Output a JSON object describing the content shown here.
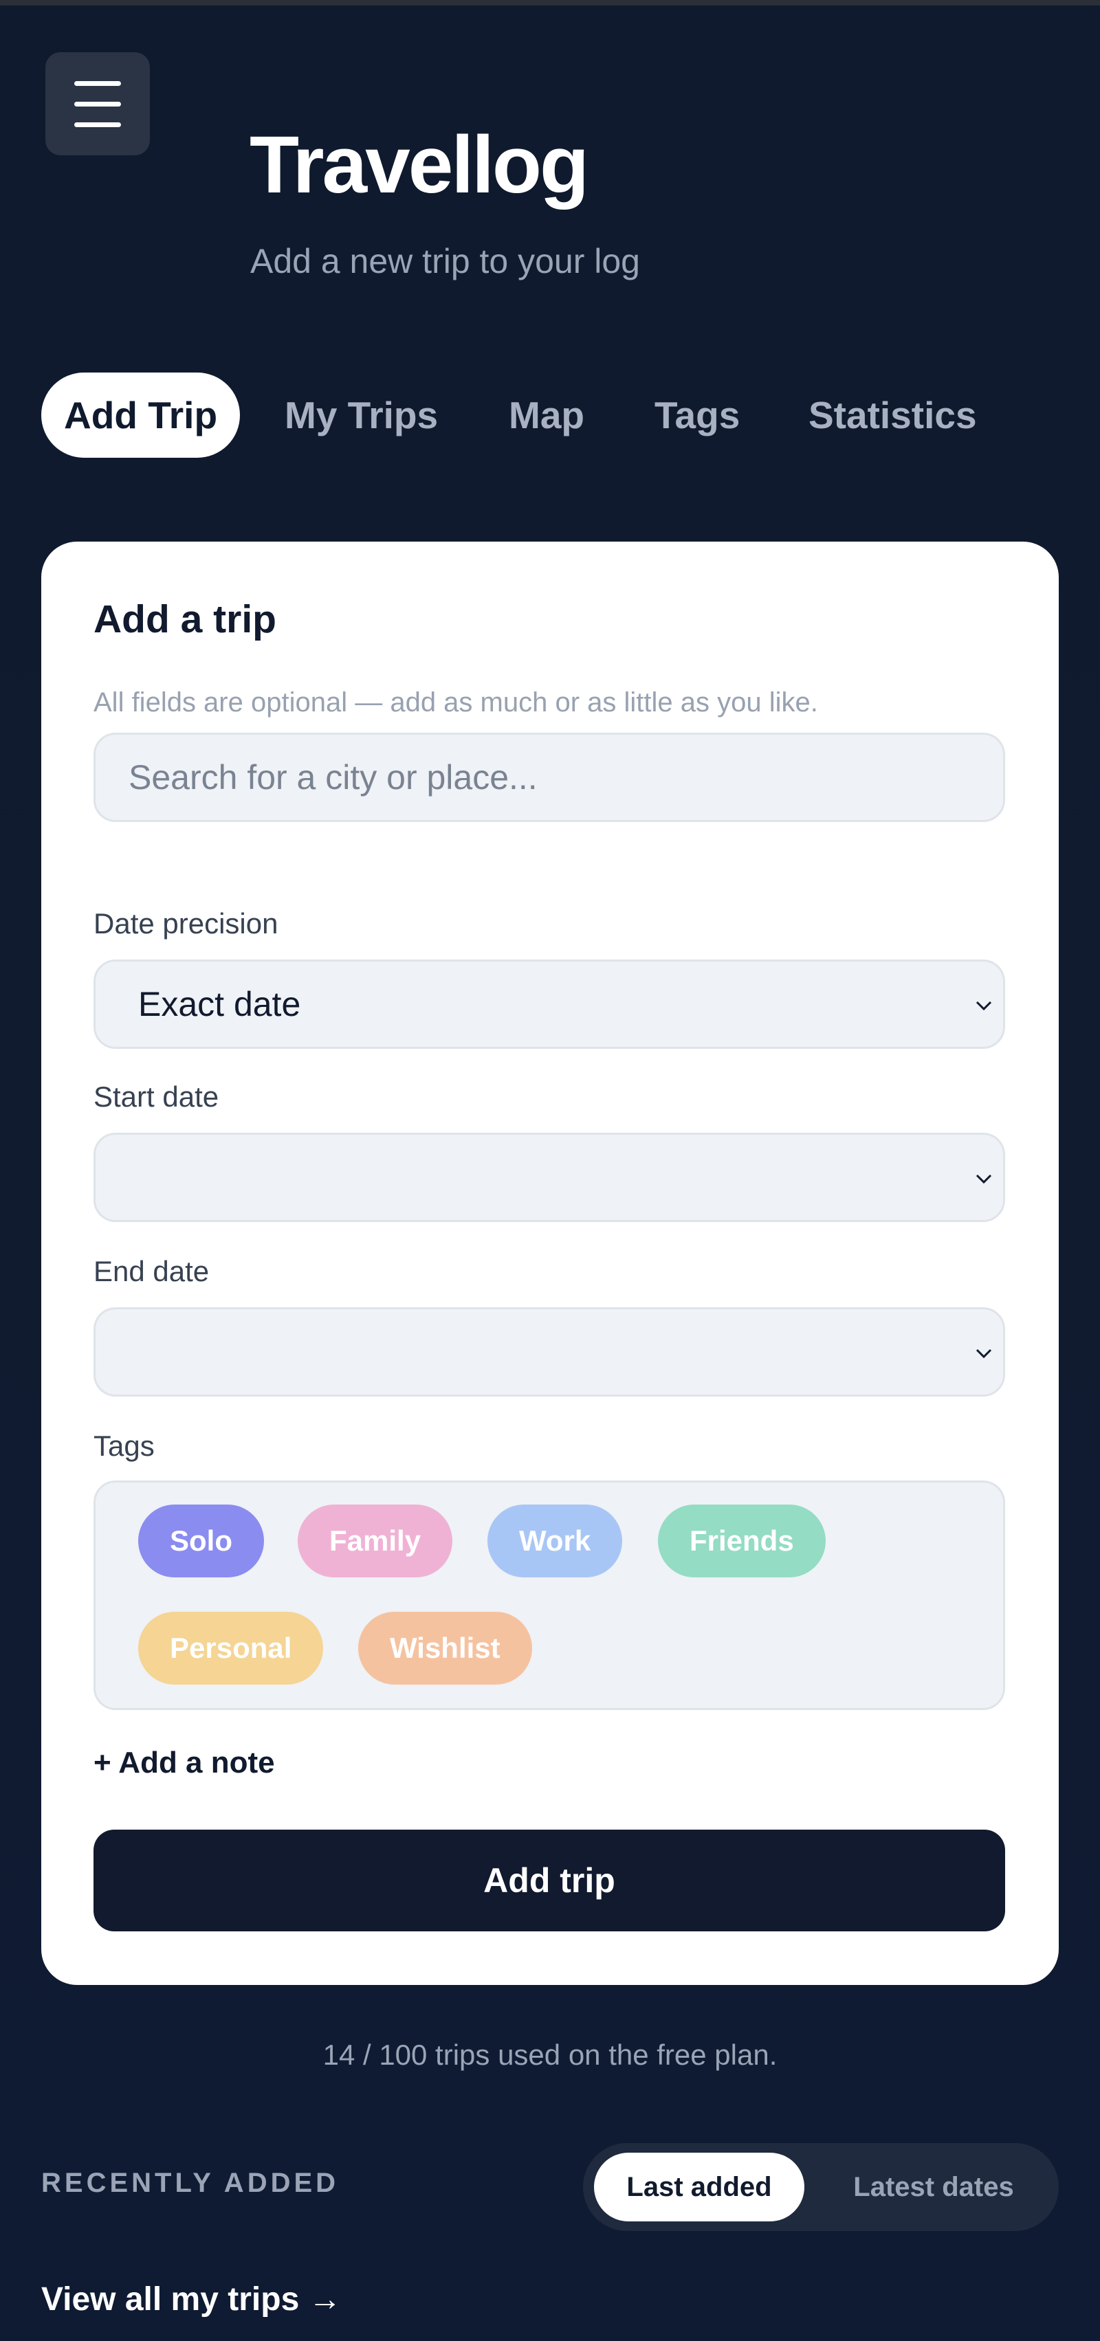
{
  "header": {
    "title": "Travellog",
    "subtitle": "Add a new trip to your log"
  },
  "tabs": [
    {
      "label": "Add Trip",
      "active": true
    },
    {
      "label": "My Trips",
      "active": false
    },
    {
      "label": "Map",
      "active": false
    },
    {
      "label": "Tags",
      "active": false
    },
    {
      "label": "Statistics",
      "active": false
    }
  ],
  "form": {
    "title": "Add a trip",
    "hint": "All fields are optional — add as much or as little as you like.",
    "search_placeholder": "Search for a city or place...",
    "date_precision": {
      "label": "Date precision",
      "value": "Exact date"
    },
    "start_date": {
      "label": "Start date",
      "value": ""
    },
    "end_date": {
      "label": "End date",
      "value": ""
    },
    "tags_label": "Tags",
    "tags": [
      {
        "label": "Solo",
        "color": "#8b8cf0"
      },
      {
        "label": "Family",
        "color": "#f0b2d4"
      },
      {
        "label": "Work",
        "color": "#a8c6f5"
      },
      {
        "label": "Friends",
        "color": "#94dcc4"
      },
      {
        "label": "Personal",
        "color": "#f5d494"
      },
      {
        "label": "Wishlist",
        "color": "#f5c2a0"
      }
    ],
    "add_note": "+ Add a note",
    "submit": "Add trip"
  },
  "usage": "14 / 100 trips used on the free plan.",
  "recent": {
    "label": "RECENTLY ADDED",
    "sort_options": [
      "Last added",
      "Latest dates"
    ],
    "view_all": "View all my trips →"
  }
}
